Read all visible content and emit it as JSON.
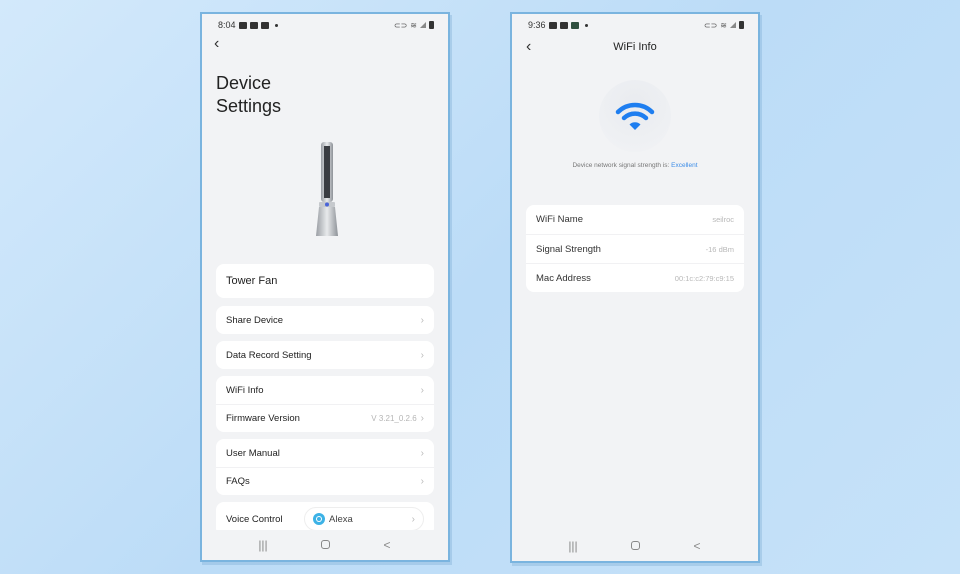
{
  "left_screen": {
    "status_bar": {
      "time": "8:04",
      "icons": [
        "gallery-icon",
        "b-icon",
        "b-icon"
      ]
    },
    "title": "Device Settings",
    "device_name": "Tower Fan",
    "groups": [
      {
        "items": [
          {
            "label": "Share Device",
            "value": ""
          }
        ]
      },
      {
        "items": [
          {
            "label": "Data Record Setting",
            "value": ""
          }
        ]
      },
      {
        "items": [
          {
            "label": "WiFi Info",
            "value": ""
          },
          {
            "label": "Firmware Version",
            "value": "V 3.21_0.2.6"
          }
        ]
      },
      {
        "items": [
          {
            "label": "User Manual",
            "value": ""
          },
          {
            "label": "FAQs",
            "value": ""
          }
        ]
      }
    ],
    "voice_control": {
      "label": "Voice Control",
      "option": "Alexa"
    }
  },
  "right_screen": {
    "status_bar": {
      "time": "9:36"
    },
    "title": "WiFi Info",
    "signal_prefix": "Device network signal strength is:",
    "signal_quality": "Excellent",
    "accent_color": "#1e7ef0",
    "info": [
      {
        "label": "WiFi Name",
        "value": "seilroc"
      },
      {
        "label": "Signal Strength",
        "value": "-16 dBm"
      },
      {
        "label": "Mac Address",
        "value": "00:1c:c2:79:c9:15"
      }
    ]
  },
  "nav": {
    "recent": "|||",
    "back": "<"
  }
}
